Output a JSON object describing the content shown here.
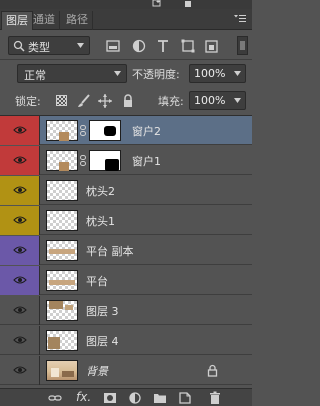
{
  "tabs": [
    {
      "label": "图层",
      "active": true
    },
    {
      "label": "通道",
      "active": false
    },
    {
      "label": "路径",
      "active": false
    }
  ],
  "filter": {
    "kind_label": "类型",
    "icons": [
      "image-filter-icon",
      "adjustment-filter-icon",
      "type-filter-icon",
      "shape-filter-icon",
      "smart-object-filter-icon"
    ]
  },
  "blend": {
    "mode": "正常",
    "opacity_label": "不透明度:",
    "opacity_value": "100%"
  },
  "lock": {
    "label": "锁定:",
    "fill_label": "填充:",
    "fill_value": "100%"
  },
  "colors": {
    "red": "#c13a3a",
    "yellow": "#b19214",
    "violet": "#6b58a8",
    "selected": "#5c6f87"
  },
  "layers": [
    {
      "name": "窗户2",
      "color": "red",
      "mask": true,
      "selected": true
    },
    {
      "name": "窗户1",
      "color": "red",
      "mask": true,
      "selected": false
    },
    {
      "name": "枕头2",
      "color": "yellow",
      "mask": false,
      "selected": false
    },
    {
      "name": "枕头1",
      "color": "yellow",
      "mask": false,
      "selected": false
    },
    {
      "name": "平台 副本",
      "color": "violet",
      "mask": false,
      "selected": false
    },
    {
      "name": "平台",
      "color": "violet",
      "mask": false,
      "selected": false
    },
    {
      "name": "图层 3",
      "color": "none",
      "mask": false,
      "selected": false
    },
    {
      "name": "图层 4",
      "color": "none",
      "mask": false,
      "selected": false
    },
    {
      "name": "背景",
      "color": "none",
      "mask": false,
      "selected": false,
      "locked": true,
      "italic": true
    }
  ],
  "bottom_icons": [
    "link-layers-icon",
    "fx-icon",
    "add-mask-icon",
    "adjustment-layer-icon",
    "new-group-icon",
    "new-layer-icon",
    "delete-layer-icon"
  ],
  "fx_label": "fx."
}
